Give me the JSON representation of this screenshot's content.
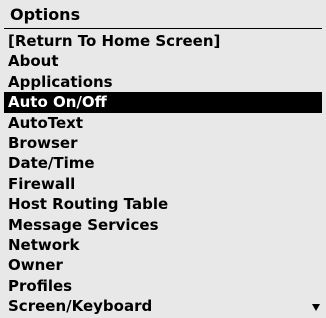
{
  "screen": {
    "title": "Options"
  },
  "menu": {
    "items": [
      {
        "label": "[Return To Home Screen]",
        "selected": false
      },
      {
        "label": "About",
        "selected": false
      },
      {
        "label": "Applications",
        "selected": false
      },
      {
        "label": "Auto On/Off",
        "selected": true
      },
      {
        "label": "AutoText",
        "selected": false
      },
      {
        "label": "Browser",
        "selected": false
      },
      {
        "label": "Date/Time",
        "selected": false
      },
      {
        "label": "Firewall",
        "selected": false
      },
      {
        "label": "Host Routing Table",
        "selected": false
      },
      {
        "label": "Message Services",
        "selected": false
      },
      {
        "label": "Network",
        "selected": false
      },
      {
        "label": "Owner",
        "selected": false
      },
      {
        "label": "Profiles",
        "selected": false
      },
      {
        "label": "Screen/Keyboard",
        "selected": false
      }
    ]
  },
  "scroll_indicator": {
    "icon": "scroll-down-arrow-icon"
  },
  "colors": {
    "background": "#e8e8e8",
    "text": "#000000",
    "selection_background": "#000000",
    "selection_text": "#ffffff"
  }
}
